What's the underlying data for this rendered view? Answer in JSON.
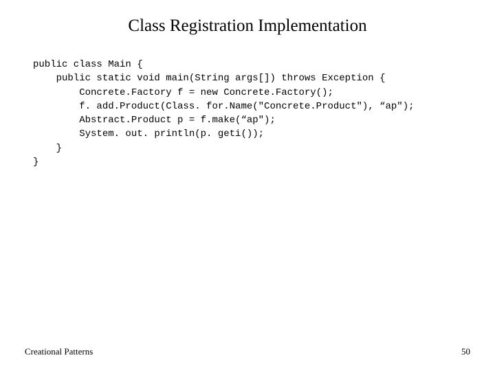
{
  "title": "Class Registration Implementation",
  "code": {
    "l1": "public class Main {",
    "l2": "    public static void main(String args[]) throws Exception {",
    "l3": "        Concrete.Factory f = new Concrete.Factory();",
    "l4": "        f. add.Product(Class. for.Name(\"Concrete.Product\"), “ap\");",
    "l5": "        Abstract.Product p = f.make(“ap\");",
    "l6": "        System. out. println(p. geti());",
    "l7": "    }",
    "l8": "}"
  },
  "footer": {
    "left": "Creational Patterns",
    "right": "50"
  }
}
